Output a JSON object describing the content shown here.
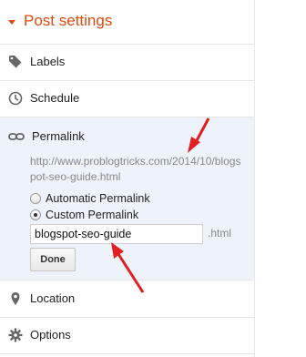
{
  "header": {
    "title": "Post settings"
  },
  "menu": {
    "labels": "Labels",
    "schedule": "Schedule",
    "location": "Location",
    "options": "Options"
  },
  "permalink": {
    "title": "Permalink",
    "url": "http://www.problogtricks.com/2014/10/blogspot-seo-guide.html",
    "automatic_label": "Automatic Permalink",
    "custom_label": "Custom Permalink",
    "selected": "custom",
    "slug_value": "blogspot-seo-guide",
    "extension": ".html",
    "done_label": "Done"
  },
  "colors": {
    "accent": "#dd4b0f",
    "selected_bg": "#eef3fb",
    "annotation": "#e02020"
  }
}
